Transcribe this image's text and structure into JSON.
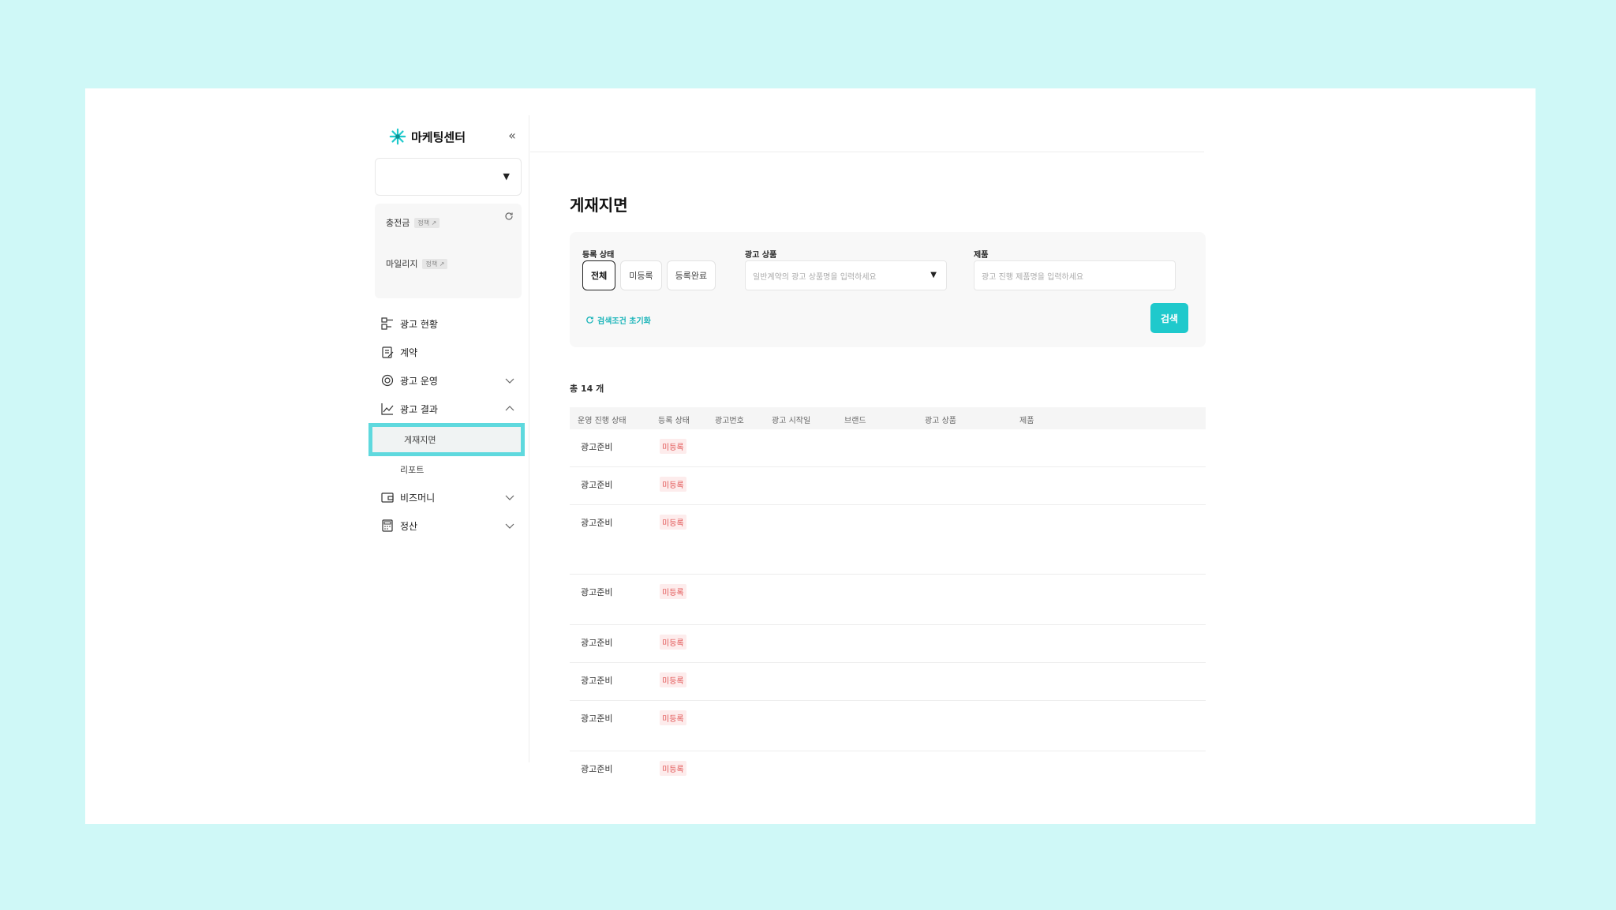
{
  "app": {
    "logo_text": "마케팅센터",
    "collapse_icon": "chevron-double-left-icon"
  },
  "account_select": {
    "value": ""
  },
  "balance": {
    "deposit_label": "충전금",
    "mileage_label": "마일리지",
    "policy_tag": "정책 ↗"
  },
  "menu": {
    "items": [
      {
        "label": "광고 현황",
        "icon": "dashboard-icon"
      },
      {
        "label": "계약",
        "icon": "contract-icon"
      },
      {
        "label": "광고 운영",
        "icon": "target-icon"
      },
      {
        "label": "광고 결과",
        "icon": "chart-line-icon"
      },
      {
        "label": "비즈머니",
        "icon": "wallet-icon"
      },
      {
        "label": "정산",
        "icon": "calculator-icon"
      }
    ],
    "sub_items": [
      {
        "label": "게재지면"
      },
      {
        "label": "리포트"
      }
    ]
  },
  "page": {
    "title": "게재지면"
  },
  "filter": {
    "status_label": "등록 상태",
    "status_options": [
      "전체",
      "미등록",
      "등록완료"
    ],
    "product_label": "광고 상품",
    "product_placeholder": "일반계약의 광고 상품명을 입력하세요",
    "item_label": "제품",
    "item_placeholder": "광고 진행 제품명을 입력하세요",
    "reset_label": "검색조건 초기화",
    "search_label": "검색"
  },
  "summary": {
    "total": "총 14 개"
  },
  "table": {
    "headers": [
      "운영 진행 상태",
      "등록 상태",
      "광고번호",
      "광고 시작일",
      "브랜드",
      "광고 상품",
      "제품"
    ],
    "rows": [
      {
        "op_status": "광고준비",
        "reg_status": "미등록"
      },
      {
        "op_status": "광고준비",
        "reg_status": "미등록"
      },
      {
        "op_status": "광고준비",
        "reg_status": "미등록"
      },
      {
        "op_status": "광고준비",
        "reg_status": "미등록"
      },
      {
        "op_status": "광고준비",
        "reg_status": "미등록"
      },
      {
        "op_status": "광고준비",
        "reg_status": "미등록"
      },
      {
        "op_status": "광고준비",
        "reg_status": "미등록"
      },
      {
        "op_status": "광고준비",
        "reg_status": "미등록"
      }
    ]
  },
  "colors": {
    "accent": "#1fc9cc",
    "highlight": "#5fd9de",
    "unregistered_text": "#e25656",
    "unregistered_bg": "#fdecec",
    "background": "#cff8f7"
  }
}
